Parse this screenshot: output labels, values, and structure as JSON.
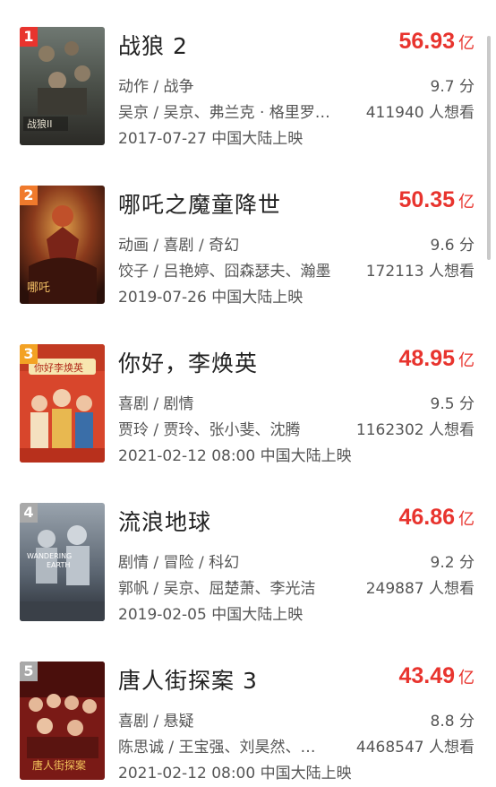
{
  "colors": {
    "accent": "#e8342e",
    "rank_top3": [
      "#e8342e",
      "#f07a2c",
      "#f3a224"
    ],
    "rank_other": "#a9a9a9"
  },
  "box_unit": "亿",
  "movies": [
    {
      "rank": "1",
      "title": "战狼 2",
      "box_office": "56.93",
      "genre": "动作 / 战争",
      "score": "9.7 分",
      "cast": "吴京 / 吴京、弗兰克 · 格里罗…",
      "want": "411940 人想看",
      "release": "2017-07-27 中国大陆上映"
    },
    {
      "rank": "2",
      "title": "哪吒之魔童降世",
      "box_office": "50.35",
      "genre": "动画 / 喜剧 / 奇幻",
      "score": "9.6 分",
      "cast": "饺子 / 吕艳婷、囧森瑟夫、瀚墨",
      "want": "172113 人想看",
      "release": "2019-07-26 中国大陆上映"
    },
    {
      "rank": "3",
      "title": "你好，李焕英",
      "box_office": "48.95",
      "genre": "喜剧 / 剧情",
      "score": "9.5 分",
      "cast": "贾玲 / 贾玲、张小斐、沈腾",
      "want": "1162302 人想看",
      "release": "2021-02-12 08:00 中国大陆上映"
    },
    {
      "rank": "4",
      "title": "流浪地球",
      "box_office": "46.86",
      "genre": "剧情 / 冒险 / 科幻",
      "score": "9.2 分",
      "cast": "郭帆 / 吴京、屈楚萧、李光洁",
      "want": "249887 人想看",
      "release": "2019-02-05 中国大陆上映"
    },
    {
      "rank": "5",
      "title": "唐人街探案 3",
      "box_office": "43.49",
      "genre": "喜剧 / 悬疑",
      "score": "8.8 分",
      "cast": "陈思诚 / 王宝强、刘昊然、…",
      "want": "4468547 人想看",
      "release": "2021-02-12 08:00 中国大陆上映"
    }
  ]
}
